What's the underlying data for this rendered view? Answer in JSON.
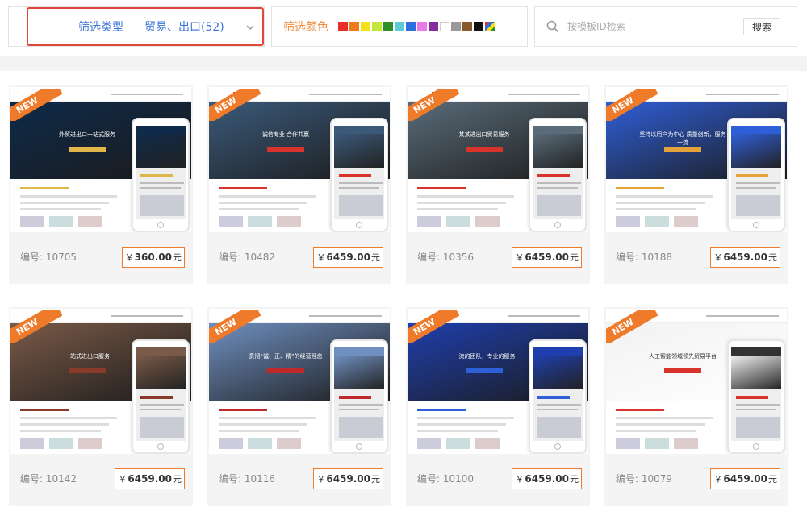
{
  "filter": {
    "type_label": "筛选类型",
    "type_value": "贸易、出口(52)",
    "color_label": "筛选颜色",
    "colors": [
      "#e8302a",
      "#f07a1f",
      "#f6e11b",
      "#c3e63a",
      "#2f8f2b",
      "#5bcbd6",
      "#2e6fe0",
      "#e87be8",
      "#8a2aa0",
      "#ffffff",
      "#999999",
      "#8b5a2b",
      "#111111",
      "multicolor"
    ],
    "search_placeholder": "按模板ID检索",
    "search_button": "搜索"
  },
  "cards": [
    {
      "new": "NEW",
      "code_label": "编号:",
      "code": "10705",
      "currency": "￥",
      "price": "360.00",
      "unit": "元",
      "theme": "#0f2a4a",
      "accent": "#e0b64a",
      "hero_title": "外贸进出口一站式服务"
    },
    {
      "new": "NEW",
      "code_label": "编号:",
      "code": "10482",
      "currency": "￥",
      "price": "6459.00",
      "unit": "元",
      "theme": "#3b5a7a",
      "accent": "#d9342b",
      "hero_title": "诚信专业 合作共赢"
    },
    {
      "new": "NEW",
      "code_label": "编号:",
      "code": "10356",
      "currency": "￥",
      "price": "6459.00",
      "unit": "元",
      "theme": "#5a6c7a",
      "accent": "#d9342b",
      "hero_title": "某某进出口贸易服务"
    },
    {
      "new": "NEW",
      "code_label": "编号:",
      "code": "10188",
      "currency": "￥",
      "price": "6459.00",
      "unit": "元",
      "theme": "#2f5fd8",
      "accent": "#e6a23a",
      "hero_title": "坚持以用户为中心 质量创新，服务一流"
    },
    {
      "new": "NEW",
      "code_label": "编号:",
      "code": "10142",
      "currency": "￥",
      "price": "6459.00",
      "unit": "元",
      "theme": "#7a5a48",
      "accent": "#8a3a2a",
      "hero_title": "一站式进出口服务"
    },
    {
      "new": "NEW",
      "code_label": "编号:",
      "code": "10116",
      "currency": "￥",
      "price": "6459.00",
      "unit": "元",
      "theme": "#6f8fc0",
      "accent": "#c0282a",
      "hero_title": "贯彻“诚、正、精”的经营理念"
    },
    {
      "new": "NEW",
      "code_label": "编号:",
      "code": "10100",
      "currency": "￥",
      "price": "6459.00",
      "unit": "元",
      "theme": "#1f3fae",
      "accent": "#2f5fd8",
      "hero_title": "一流的团队，专业的服务"
    },
    {
      "new": "NEW",
      "code_label": "编号:",
      "code": "10079",
      "currency": "￥",
      "price": "6459.00",
      "unit": "元",
      "theme": "#f2f2f2",
      "accent": "#d9342b",
      "hero_title": "人工智能领域领先贸易平台"
    }
  ]
}
